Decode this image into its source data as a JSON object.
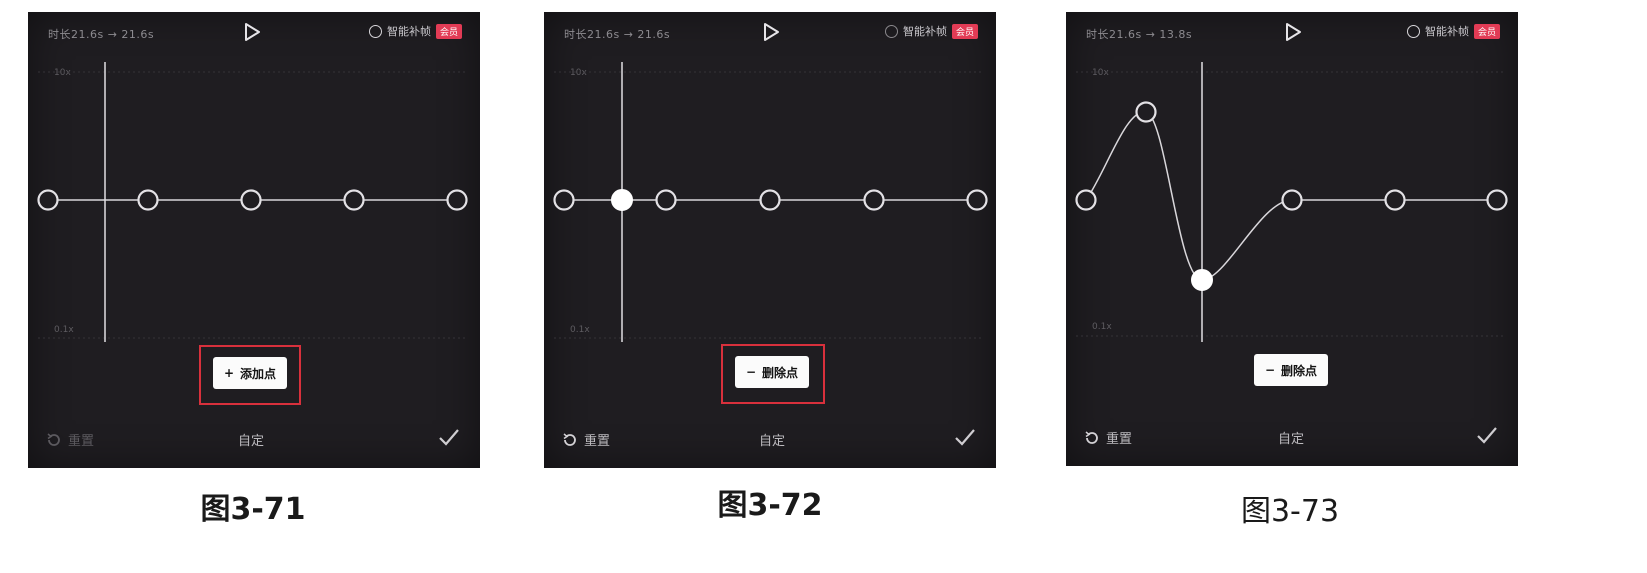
{
  "panels": [
    {
      "topbar": {
        "duration_text": "时长21.6s → 21.6s",
        "smart_label": "智能补帧",
        "vip_badge": "会员"
      },
      "y_top_label": "10x",
      "y_bottom_label": "0.1x",
      "action_label": "添加点",
      "action_symbol": "+",
      "highlighted": true,
      "bottom": {
        "reset_label": "重置",
        "title": "自定"
      },
      "caption": "图3-71"
    },
    {
      "topbar": {
        "duration_text": "时长21.6s → 21.6s",
        "smart_label": "智能补帧",
        "vip_badge": "会员"
      },
      "y_top_label": "10x",
      "y_bottom_label": "0.1x",
      "action_label": "删除点",
      "action_symbol": "−",
      "highlighted": true,
      "bottom": {
        "reset_label": "重置",
        "title": "自定"
      },
      "caption": "图3-72"
    },
    {
      "topbar": {
        "duration_text": "时长21.6s → 13.8s",
        "smart_label": "智能补帧",
        "vip_badge": "会员"
      },
      "y_top_label": "10x",
      "y_bottom_label": "0.1x",
      "action_label": "删除点",
      "action_symbol": "−",
      "highlighted": false,
      "bottom": {
        "reset_label": "重置",
        "title": "自定"
      },
      "caption": "图3-73"
    }
  ],
  "colors": {
    "panel_bg": "#1f1d21",
    "highlight": "#d8303c",
    "vip": "#e23b55",
    "curve": "#d9d7db",
    "selected_point": "#ffffff"
  },
  "icons": [
    "play-icon",
    "smart-frame-ring-icon",
    "reset-icon",
    "check-icon",
    "control-point-icon",
    "selected-point-icon"
  ]
}
